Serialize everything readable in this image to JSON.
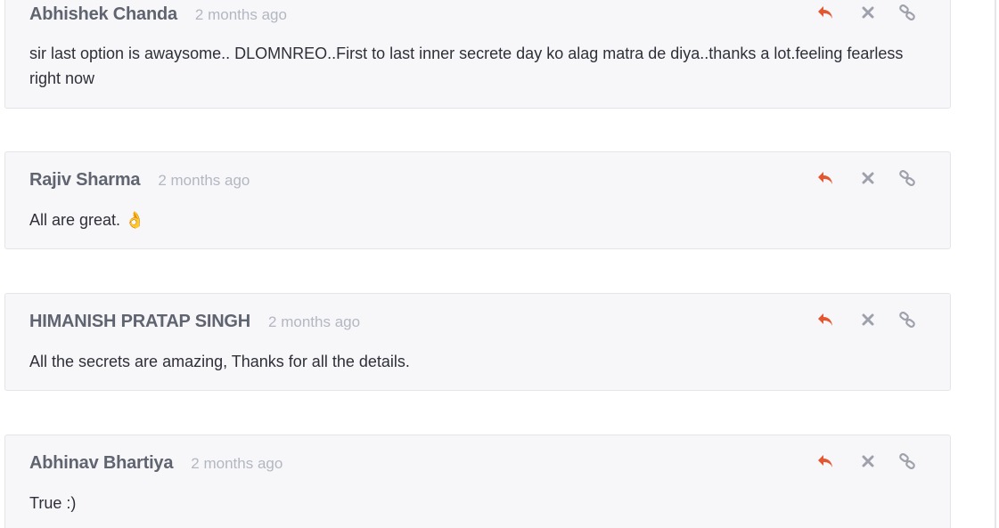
{
  "colors": {
    "reply_icon": "#e4562f",
    "muted_icon": "#9ea1ab",
    "card_bg": "#f7f7f9",
    "author_text": "#5f6470",
    "time_text": "#b3b7c1"
  },
  "icons": {
    "reply": "reply-arrow-icon",
    "delete": "close-x-icon",
    "permalink": "chain-link-icon"
  },
  "comments": [
    {
      "author": "Abhishek Chanda",
      "time": "2 months ago",
      "text": "sir last option is awaysome.. DLOMNREO..First to last inner secrete day ko alag matra de diya..thanks a lot.feeling fearless right now"
    },
    {
      "author": "Rajiv Sharma",
      "time": "2 months ago",
      "text": "All are great. 👌"
    },
    {
      "author": "HIMANISH PRATAP SINGH",
      "time": "2 months ago",
      "text": "All the secrets are amazing, Thanks for all the details."
    },
    {
      "author": "Abhinav Bhartiya",
      "time": "2 months ago",
      "text": "True :)"
    }
  ]
}
